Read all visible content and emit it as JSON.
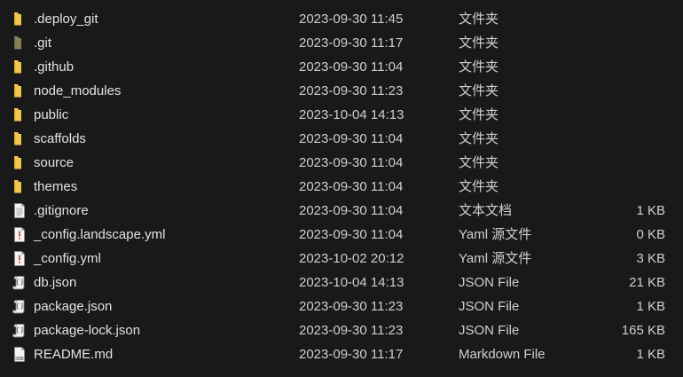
{
  "colors": {
    "background": "#191919",
    "folder": "#f2c54d",
    "git_folder": "#8a7d5a"
  },
  "files": [
    {
      "name": ".deploy_git",
      "date": "2023-09-30 11:45",
      "type": "文件夹",
      "size": "",
      "icon": "folder-icon"
    },
    {
      "name": ".git",
      "date": "2023-09-30 11:17",
      "type": "文件夹",
      "size": "",
      "icon": "git-folder-icon"
    },
    {
      "name": ".github",
      "date": "2023-09-30 11:04",
      "type": "文件夹",
      "size": "",
      "icon": "folder-icon"
    },
    {
      "name": "node_modules",
      "date": "2023-09-30 11:23",
      "type": "文件夹",
      "size": "",
      "icon": "folder-icon"
    },
    {
      "name": "public",
      "date": "2023-10-04 14:13",
      "type": "文件夹",
      "size": "",
      "icon": "folder-icon"
    },
    {
      "name": "scaffolds",
      "date": "2023-09-30 11:04",
      "type": "文件夹",
      "size": "",
      "icon": "folder-icon"
    },
    {
      "name": "source",
      "date": "2023-09-30 11:04",
      "type": "文件夹",
      "size": "",
      "icon": "folder-icon"
    },
    {
      "name": "themes",
      "date": "2023-09-30 11:04",
      "type": "文件夹",
      "size": "",
      "icon": "folder-icon"
    },
    {
      "name": ".gitignore",
      "date": "2023-09-30 11:04",
      "type": "文本文档",
      "size": "1 KB",
      "icon": "text-document-icon"
    },
    {
      "name": "_config.landscape.yml",
      "date": "2023-09-30 11:04",
      "type": "Yaml 源文件",
      "size": "0 KB",
      "icon": "yaml-file-icon"
    },
    {
      "name": "_config.yml",
      "date": "2023-10-02 20:12",
      "type": "Yaml 源文件",
      "size": "3 KB",
      "icon": "yaml-file-icon"
    },
    {
      "name": "db.json",
      "date": "2023-10-04 14:13",
      "type": "JSON File",
      "size": "21 KB",
      "icon": "json-file-icon"
    },
    {
      "name": "package.json",
      "date": "2023-09-30 11:23",
      "type": "JSON File",
      "size": "1 KB",
      "icon": "json-file-icon"
    },
    {
      "name": "package-lock.json",
      "date": "2023-09-30 11:23",
      "type": "JSON File",
      "size": "165 KB",
      "icon": "json-file-icon"
    },
    {
      "name": "README.md",
      "date": "2023-09-30 11:17",
      "type": "Markdown File",
      "size": "1 KB",
      "icon": "markdown-file-icon"
    }
  ]
}
